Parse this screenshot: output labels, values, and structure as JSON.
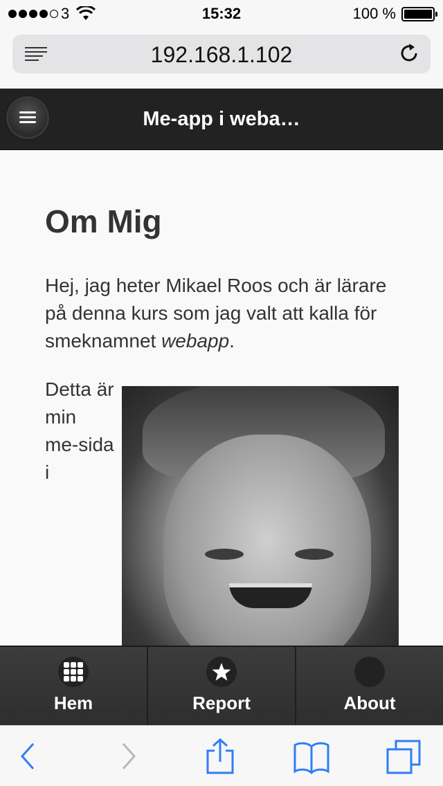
{
  "status_bar": {
    "carrier": "3",
    "time": "15:32",
    "battery": "100 %"
  },
  "browser": {
    "url": "192.168.1.102"
  },
  "app_header": {
    "title": "Me-app i weba…"
  },
  "content": {
    "heading": "Om Mig",
    "intro_text": "Hej, jag heter Mikael Roos och är lärare på denna kurs som jag valt att kalla för smeknamnet ",
    "intro_emphasis": "webapp",
    "intro_end": ".",
    "float_text": "Detta är min me-sida i"
  },
  "navbar": {
    "items": [
      {
        "label": "Hem",
        "icon": "grid-icon"
      },
      {
        "label": "Report",
        "icon": "star-icon"
      },
      {
        "label": "About",
        "icon": "blank-circle-icon"
      }
    ]
  },
  "colors": {
    "header_bg": "#222222",
    "navbar_bg": "#333333",
    "ios_blue": "#2f7ef6"
  }
}
